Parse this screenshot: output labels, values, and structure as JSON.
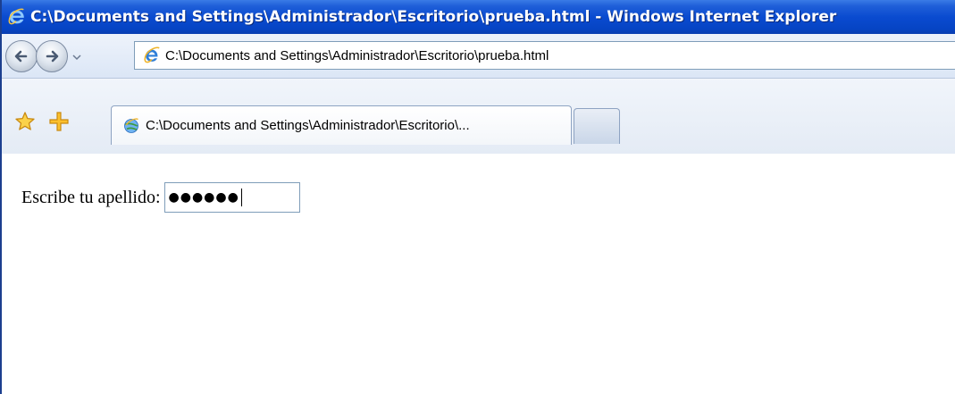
{
  "window": {
    "title": "C:\\Documents and Settings\\Administrador\\Escritorio\\prueba.html - Windows Internet Explorer"
  },
  "navigation": {
    "back_icon": "back-arrow-icon",
    "forward_icon": "forward-arrow-icon",
    "dropdown_icon": "chevron-down-icon"
  },
  "address_bar": {
    "url": "C:\\Documents and Settings\\Administrador\\Escritorio\\prueba.html",
    "icon": "ie-page-icon"
  },
  "favorites": {
    "star_icon": "favorites-star-icon",
    "add_icon": "add-favorites-icon"
  },
  "tabs": [
    {
      "label": "C:\\Documents and Settings\\Administrador\\Escritorio\\..."
    }
  ],
  "content": {
    "label": "Escribe tu apellido:",
    "password_mask": "●●●●●●"
  },
  "colors": {
    "titlebar": "#0a4bd0",
    "titlebar_text": "#ffffff"
  }
}
